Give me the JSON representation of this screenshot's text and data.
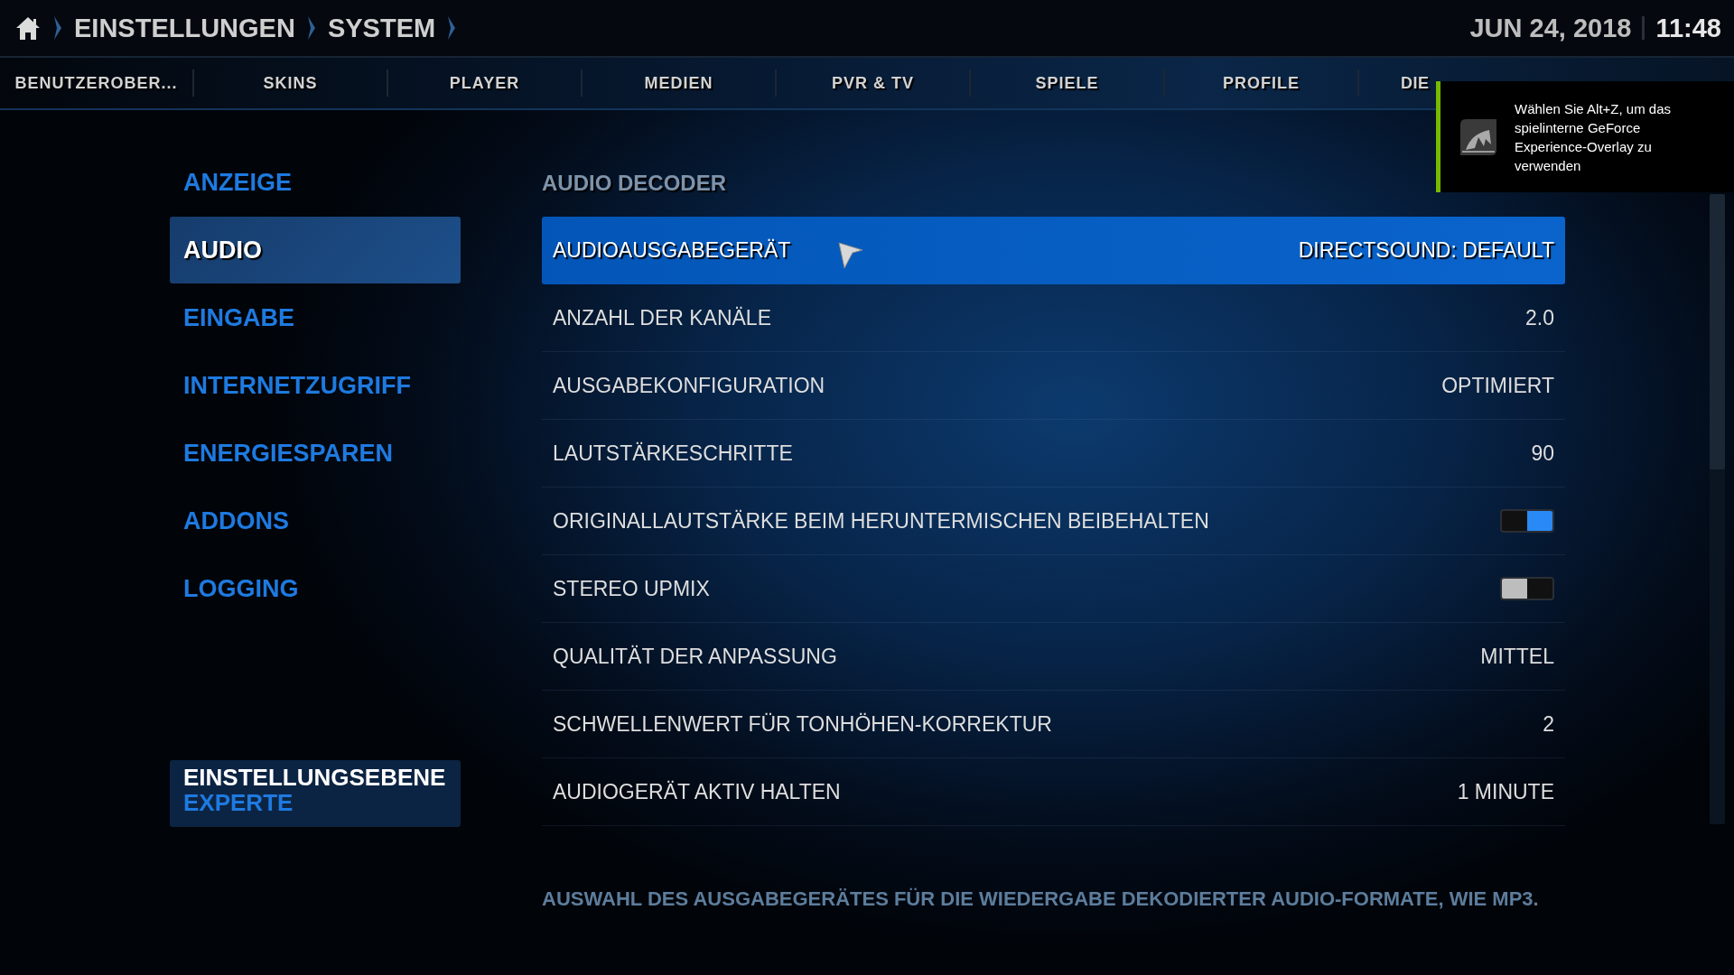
{
  "breadcrumb": {
    "items": [
      "EINSTELLUNGEN",
      "SYSTEM"
    ]
  },
  "clock": {
    "date": "JUN 24, 2018",
    "time": "11:48"
  },
  "tabs": [
    {
      "label": "BENUTZEROBER...",
      "selected": false
    },
    {
      "label": "SKINS",
      "selected": false
    },
    {
      "label": "PLAYER",
      "selected": false
    },
    {
      "label": "MEDIEN",
      "selected": false
    },
    {
      "label": "PVR & TV",
      "selected": false
    },
    {
      "label": "SPIELE",
      "selected": false
    },
    {
      "label": "PROFILE",
      "selected": false
    },
    {
      "label": "DIE",
      "selected": false
    }
  ],
  "sidebar": {
    "items": [
      {
        "label": "ANZEIGE",
        "selected": false
      },
      {
        "label": "AUDIO",
        "selected": true
      },
      {
        "label": "EINGABE",
        "selected": false
      },
      {
        "label": "INTERNETZUGRIFF",
        "selected": false
      },
      {
        "label": "ENERGIESPAREN",
        "selected": false
      },
      {
        "label": "ADDONS",
        "selected": false
      },
      {
        "label": "LOGGING",
        "selected": false
      }
    ],
    "settings_level": {
      "label": "EINSTELLUNGSEBENE",
      "value": "EXPERTE"
    }
  },
  "section": {
    "title": "AUDIO DECODER"
  },
  "settings": [
    {
      "kind": "value",
      "label": "AUDIOAUSGABEGERÄT",
      "value": "DIRECTSOUND: DEFAULT",
      "selected": true
    },
    {
      "kind": "value",
      "label": "ANZAHL DER KANÄLE",
      "value": "2.0",
      "selected": false
    },
    {
      "kind": "value",
      "label": "AUSGABEKONFIGURATION",
      "value": "OPTIMIERT",
      "selected": false
    },
    {
      "kind": "value",
      "label": "LAUTSTÄRKESCHRITTE",
      "value": "90",
      "selected": false
    },
    {
      "kind": "toggle",
      "label": "ORIGINALLAUTSTÄRKE BEIM HERUNTERMISCHEN BEIBEHALTEN",
      "on": true,
      "selected": false
    },
    {
      "kind": "toggle",
      "label": "STEREO UPMIX",
      "on": false,
      "selected": false
    },
    {
      "kind": "value",
      "label": "QUALITÄT DER ANPASSUNG",
      "value": "MITTEL",
      "selected": false
    },
    {
      "kind": "value",
      "label": "SCHWELLENWERT FÜR TONHÖHEN-KORREKTUR",
      "value": "2",
      "selected": false
    },
    {
      "kind": "value",
      "label": "AUDIOGERÄT AKTIV HALTEN",
      "value": "1 MINUTE",
      "selected": false
    }
  ],
  "description": "AUSWAHL DES AUSGABEGERÄTES FÜR DIE WIEDERGABE DEKODIERTER AUDIO-FORMATE, WIE MP3.",
  "notification": {
    "text": "Wählen Sie Alt+Z, um das spielinterne GeForce Experience-Overlay zu verwenden"
  }
}
